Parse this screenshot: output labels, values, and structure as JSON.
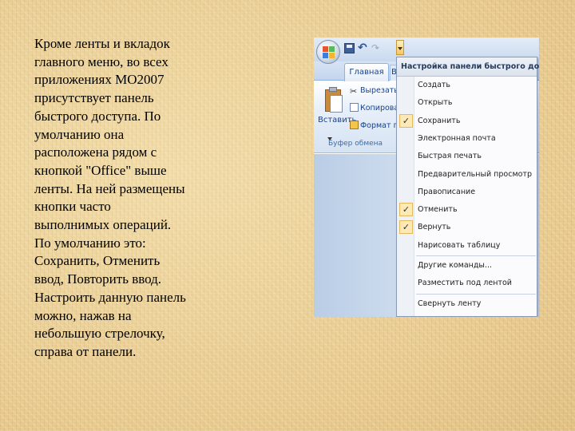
{
  "slide": {
    "text": "Кроме ленты и вкладок\nглавного меню, во всех\nприложениях МО2007\nприсутствует панель\nбыстрого доступа. По\nумолчанию она\nрасположена рядом с\nкнопкой \"Office\" выше\nленты. На ней размещены\nкнопки часто\nвыполнимых операций.\nПо умолчанию это:\nСохранить, Отменить\nввод, Повторить ввод.\nНастроить данную панель\nможно, нажав на\nнебольшую стрелочку,\nсправа от панели."
  },
  "ribbon": {
    "home_tab": "Главная",
    "other_tab": "В",
    "paste_label": "Вставить",
    "cut_label": "Вырезать",
    "copy_label": "Копировать",
    "format_label": "Формат по",
    "group_label": "Буфер обмена"
  },
  "qat_menu": {
    "header": "Настройка панели быстрого доступа",
    "items": [
      {
        "label": "Создать",
        "checked": false
      },
      {
        "label": "Открыть",
        "checked": false
      },
      {
        "label": "Сохранить",
        "checked": true
      },
      {
        "label": "Электронная почта",
        "checked": false
      },
      {
        "label": "Быстрая печать",
        "checked": false
      },
      {
        "label": "Предварительный просмотр",
        "checked": false
      },
      {
        "label": "Правописание",
        "checked": false
      },
      {
        "label": "Отменить",
        "checked": true
      },
      {
        "label": "Вернуть",
        "checked": true
      },
      {
        "label": "Нарисовать таблицу",
        "checked": false
      },
      {
        "label": "Другие команды...",
        "checked": false
      },
      {
        "label": "Разместить под лентой",
        "checked": false
      },
      {
        "label": "Свернуть ленту",
        "checked": false
      }
    ],
    "check_glyph": "✓"
  },
  "colors": {
    "slide_background": "#e9cf98",
    "ribbon_text": "#15428b",
    "menu_check_bg": "#fce9b5"
  },
  "icons": {
    "office_button": "office-logo-icon",
    "save": "save-icon",
    "undo": "undo-icon",
    "redo": "redo-icon",
    "customize": "chevron-down-icon",
    "paste": "clipboard-icon",
    "cut": "scissors-icon",
    "copy": "copy-icon",
    "format_painter": "format-painter-icon"
  }
}
